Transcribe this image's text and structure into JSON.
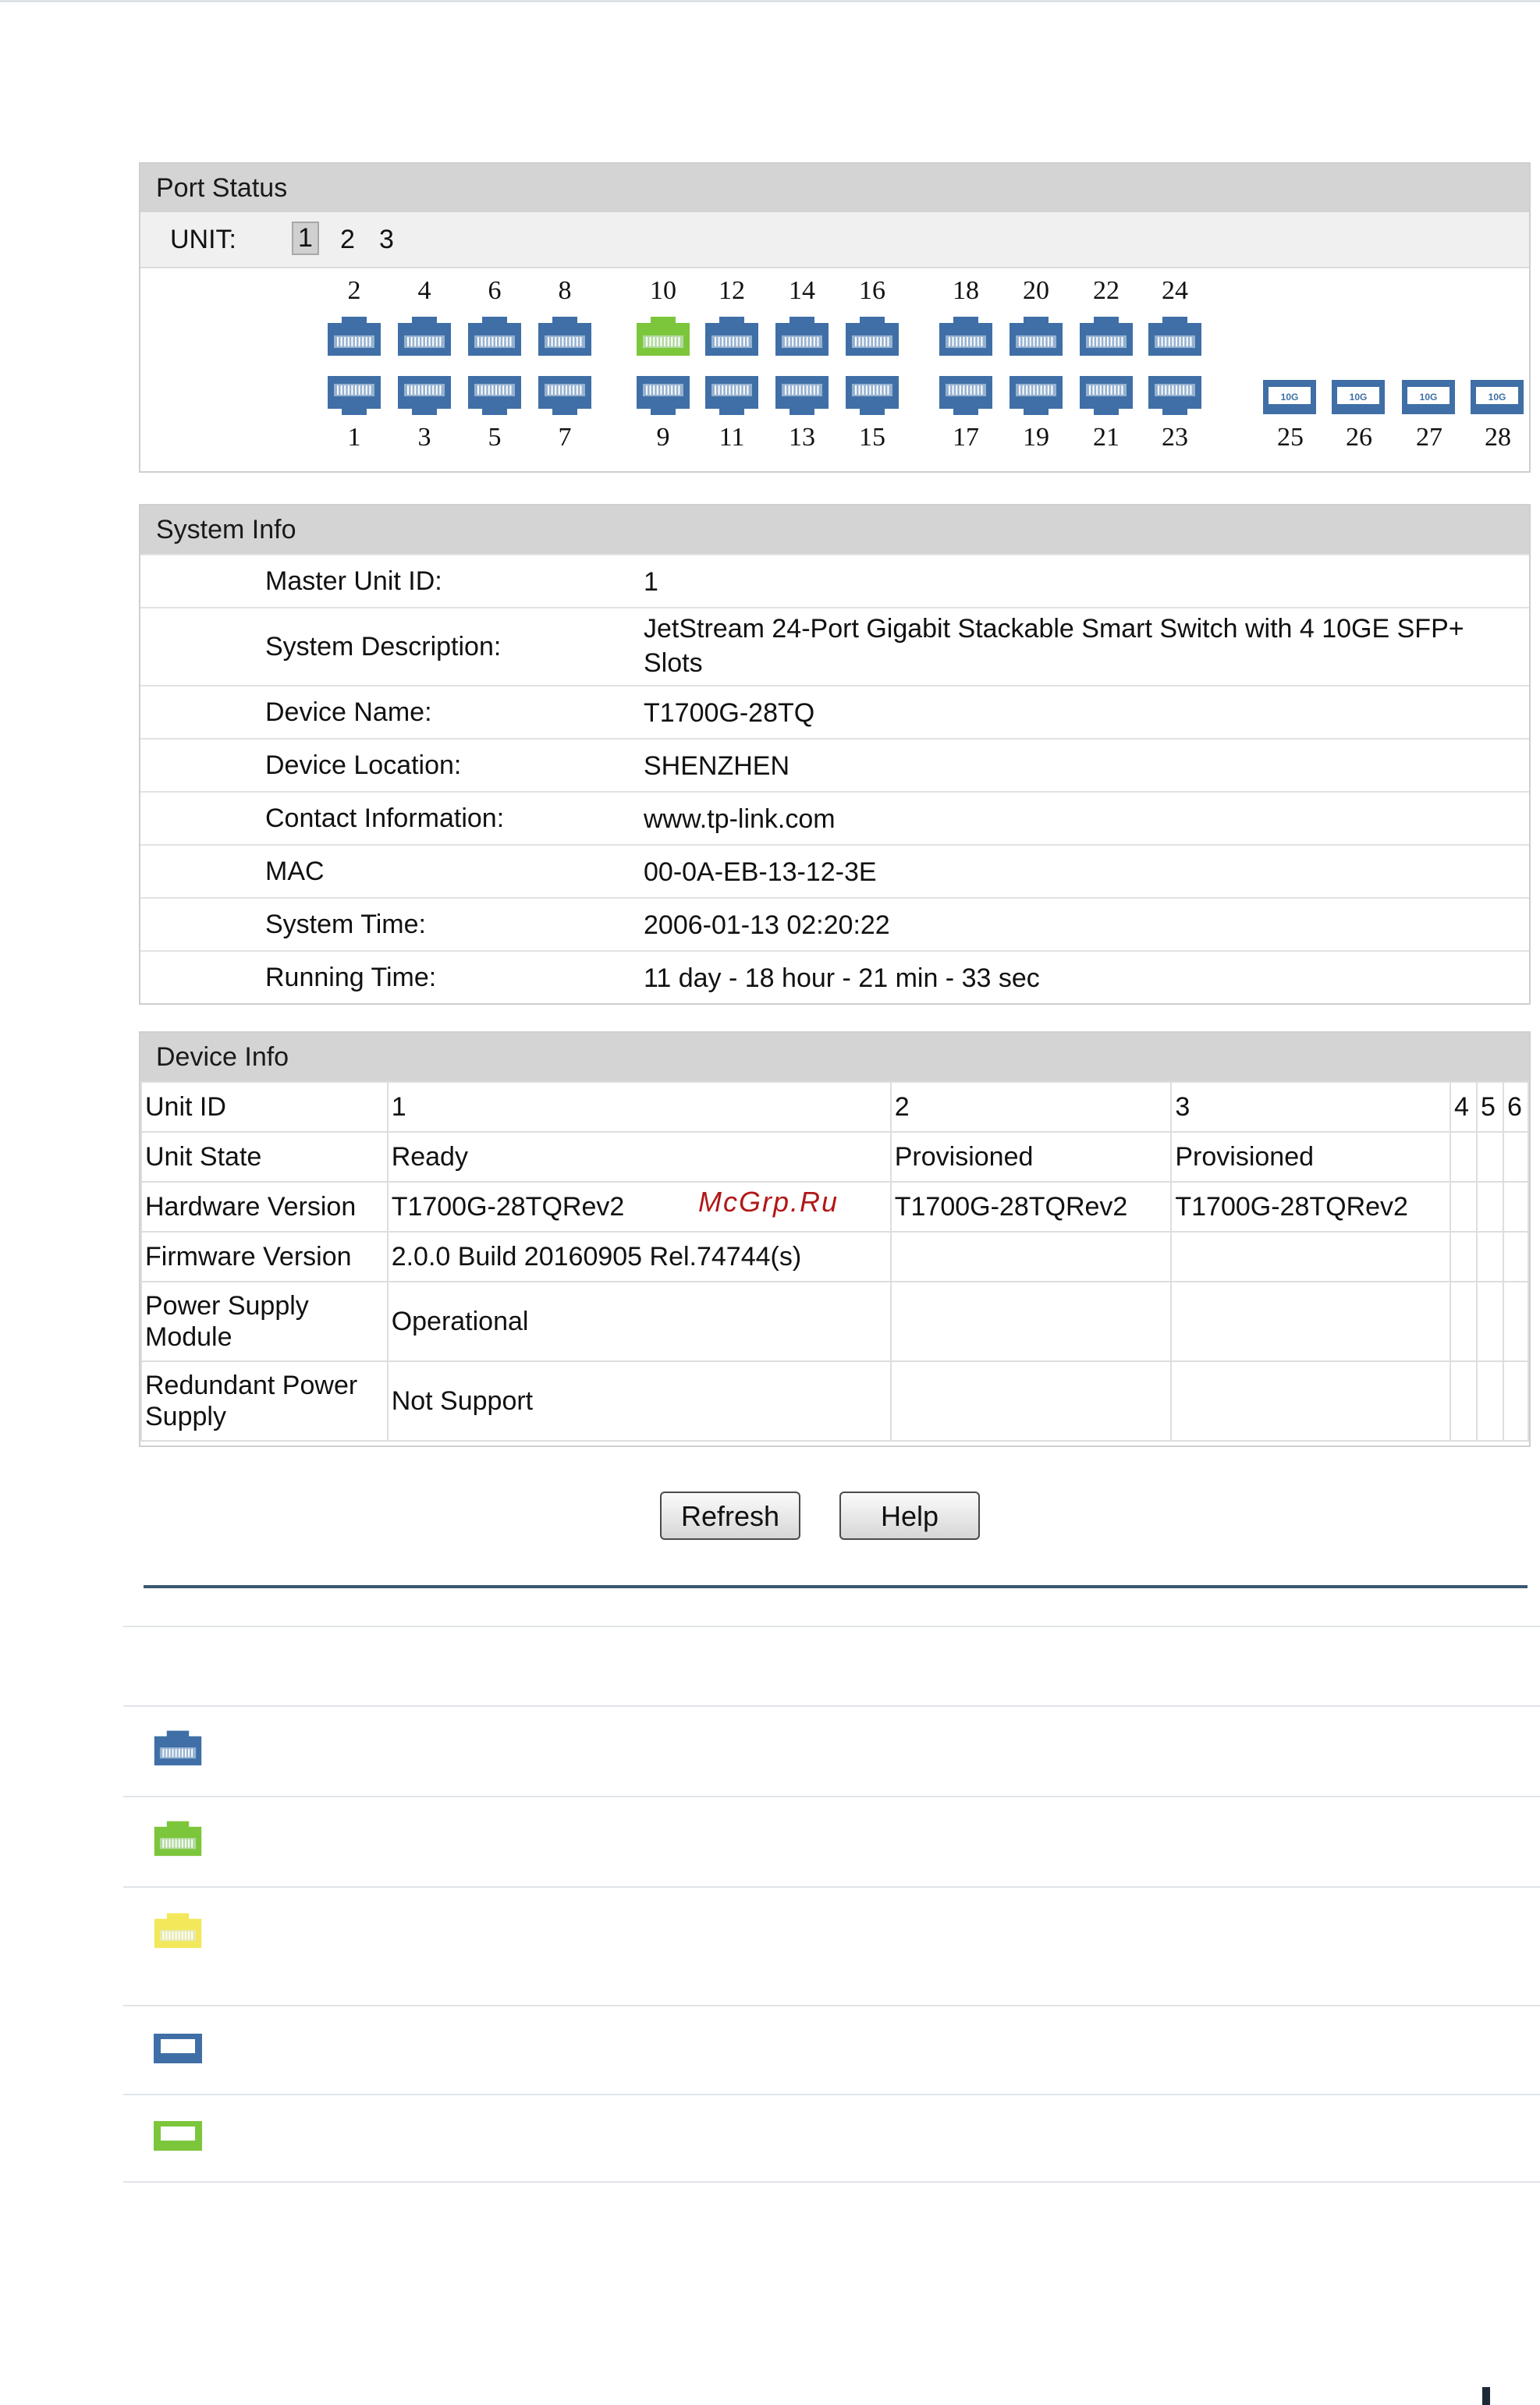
{
  "port_status": {
    "title": "Port Status",
    "unit_label": "UNIT:",
    "units": [
      "1",
      "2",
      "3"
    ],
    "selected_unit": "1",
    "top_ports": [
      "2",
      "4",
      "6",
      "8",
      "10",
      "12",
      "14",
      "16",
      "18",
      "20",
      "22",
      "24"
    ],
    "bottom_ports": [
      "1",
      "3",
      "5",
      "7",
      "9",
      "11",
      "13",
      "15",
      "17",
      "19",
      "21",
      "23"
    ],
    "sfp_ports": [
      "25",
      "26",
      "27",
      "28"
    ],
    "sfp_badge": "10G",
    "linked_ports": [
      "10"
    ],
    "colors": {
      "port_blue": "#3f6fa6",
      "port_green": "#7cc63b",
      "port_yellow": "#f2e85a"
    }
  },
  "system_info": {
    "title": "System Info",
    "rows": [
      {
        "label": "Master Unit ID:",
        "value": "1"
      },
      {
        "label": "System Description:",
        "value": "JetStream 24-Port Gigabit Stackable Smart Switch with 4 10GE SFP+ Slots"
      },
      {
        "label": "Device Name:",
        "value": "T1700G-28TQ"
      },
      {
        "label": "Device Location:",
        "value": "SHENZHEN"
      },
      {
        "label": "Contact Information:",
        "value": "www.tp-link.com"
      },
      {
        "label": "MAC",
        "value": "00-0A-EB-13-12-3E"
      },
      {
        "label": "System Time:",
        "value": "2006-01-13 02:20:22"
      },
      {
        "label": "Running Time:",
        "value": "11 day - 18 hour - 21 min - 33 sec"
      }
    ]
  },
  "device_info": {
    "title": "Device Info",
    "header": [
      "Unit ID",
      "1",
      "2",
      "3",
      "4",
      "5",
      "6"
    ],
    "rows": [
      [
        "Unit State",
        "Ready",
        "Provisioned",
        "Provisioned",
        "",
        "",
        ""
      ],
      [
        "Hardware Version",
        "T1700G-28TQRev2",
        "T1700G-28TQRev2",
        "T1700G-28TQRev2",
        "",
        "",
        ""
      ],
      [
        "Firmware Version",
        "2.0.0 Build 20160905 Rel.74744(s)",
        "",
        "",
        "",
        "",
        ""
      ],
      [
        "Power Supply Module",
        "Operational",
        "",
        "",
        "",
        "",
        ""
      ],
      [
        "Redundant Power Supply",
        "Not Support",
        "",
        "",
        "",
        "",
        ""
      ]
    ]
  },
  "watermark": "McGrp.Ru",
  "buttons": {
    "refresh": "Refresh",
    "help": "Help"
  },
  "legend_icons": [
    "port-blue-icon",
    "port-green-icon",
    "port-yellow-icon",
    "sfp-blue-icon",
    "sfp-green-icon"
  ]
}
